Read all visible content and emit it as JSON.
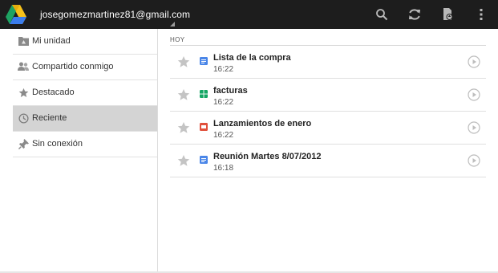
{
  "topbar": {
    "account": "josegomezmartinez81@gmail.com",
    "actions": [
      {
        "icon": "search-icon"
      },
      {
        "icon": "refresh-icon"
      },
      {
        "icon": "upload-icon"
      },
      {
        "icon": "overflow-menu-icon"
      }
    ],
    "colors": {
      "bar": "#1d1d1d",
      "text": "#ffffff",
      "icon": "#b8b8b8"
    }
  },
  "sidebar": {
    "items": [
      {
        "label": "Mi unidad",
        "icon": "drive-folder-icon",
        "active": false
      },
      {
        "label": "Compartido conmigo",
        "icon": "people-icon",
        "active": false
      },
      {
        "label": "Destacado",
        "icon": "star-icon",
        "active": false
      },
      {
        "label": "Reciente",
        "icon": "clock-icon",
        "active": true
      },
      {
        "label": "Sin conexión",
        "icon": "pin-icon",
        "active": false
      }
    ],
    "active_color": "#d4d4d4"
  },
  "main": {
    "section_header": "HOY",
    "files": [
      {
        "name": "Lista de la compra",
        "time": "16:22",
        "type_icon": "document-icon",
        "type_color": "#4a86e8"
      },
      {
        "name": "facturas",
        "time": "16:22",
        "type_icon": "spreadsheet-icon",
        "type_color": "#16a765"
      },
      {
        "name": "Lanzamientos de enero",
        "time": "16:22",
        "type_icon": "presentation-icon",
        "type_color": "#e0503c"
      },
      {
        "name": "Reunión Martes 8/07/2012",
        "time": "16:18",
        "type_icon": "document-icon",
        "type_color": "#4a86e8"
      }
    ]
  }
}
